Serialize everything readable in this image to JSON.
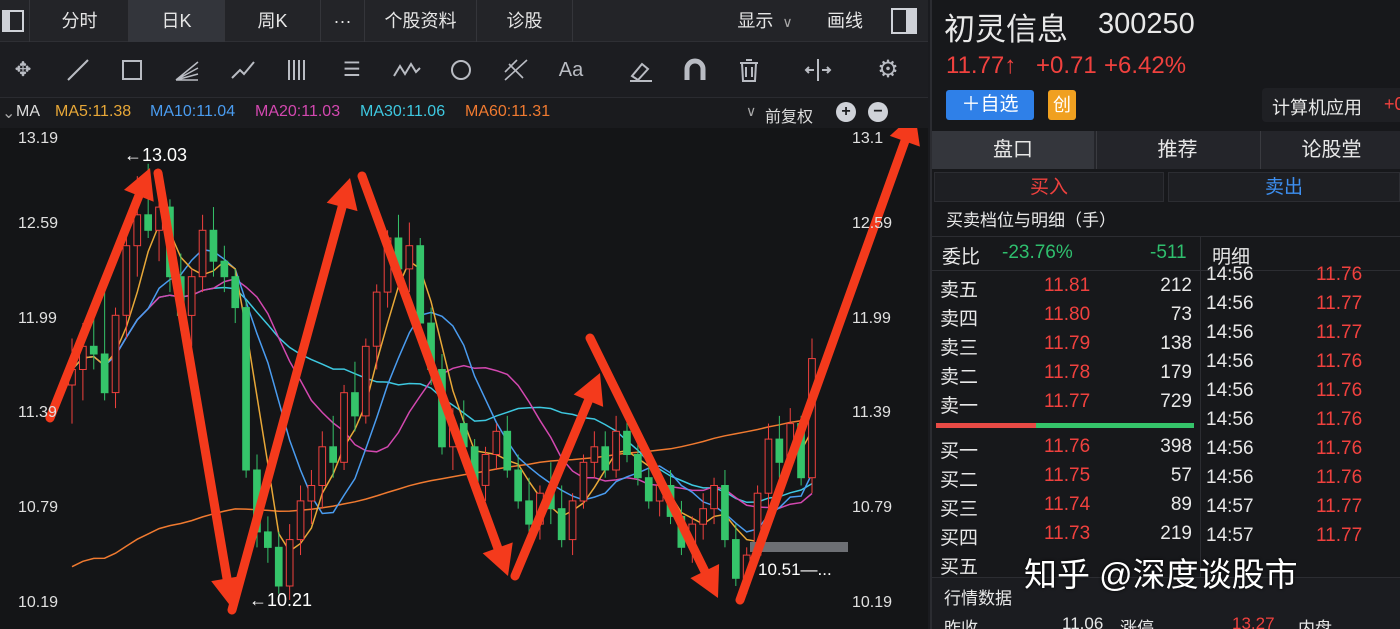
{
  "tabs": {
    "fenshi": "分时",
    "rik": "日K",
    "zhouk": "周K",
    "more": "···",
    "profile": "个股资料",
    "diagnose": "诊股",
    "display": "显示",
    "drawline": "画线"
  },
  "toolbar_icons": [
    "move-icon",
    "line-icon",
    "rect-icon",
    "fan-icon",
    "pen-icon",
    "bars-icon",
    "text-lines-icon",
    "wave-icon",
    "cycle-icon",
    "fib-icon",
    "text-icon",
    "eraser-icon",
    "magnet-icon",
    "trash-icon",
    "split-icon",
    "gear-icon"
  ],
  "ma_bar": {
    "label": "MA",
    "ma5": "MA5:11.38",
    "ma10": "MA10:11.04",
    "ma20": "MA20:11.03",
    "ma30": "MA30:11.06",
    "ma60": "MA60:11.31",
    "adjust": "前复权",
    "colors": {
      "ma5": "#e8a838",
      "ma10": "#4a9cf0",
      "ma20": "#d348b0",
      "ma30": "#3ec8e0",
      "ma60": "#f07a30"
    }
  },
  "chart_data": {
    "type": "candlestick",
    "y_ticks_left": [
      "13.19",
      "12.59",
      "11.99",
      "11.39",
      "10.79",
      "10.19"
    ],
    "y_ticks_right": [
      "13.1",
      "12.59",
      "11.99",
      "11.39",
      "10.79",
      "10.19"
    ],
    "ylim": [
      10.19,
      13.19
    ],
    "high_label": "←13.03",
    "low_label": "←10.21",
    "price_tag": "10.51—...",
    "up_color": "#f0413e",
    "down_color": "#35c46a",
    "candles": [
      {
        "o": 11.6,
        "h": 11.9,
        "l": 11.35,
        "c": 11.7
      },
      {
        "o": 11.7,
        "h": 12.0,
        "l": 11.5,
        "c": 11.85
      },
      {
        "o": 11.85,
        "h": 12.15,
        "l": 11.7,
        "c": 11.8
      },
      {
        "o": 11.8,
        "h": 12.2,
        "l": 11.5,
        "c": 11.55
      },
      {
        "o": 11.55,
        "h": 12.1,
        "l": 11.45,
        "c": 12.05
      },
      {
        "o": 12.05,
        "h": 12.6,
        "l": 11.9,
        "c": 12.5
      },
      {
        "o": 12.5,
        "h": 12.95,
        "l": 12.3,
        "c": 12.7
      },
      {
        "o": 12.7,
        "h": 13.03,
        "l": 12.55,
        "c": 12.6
      },
      {
        "o": 12.6,
        "h": 12.85,
        "l": 12.4,
        "c": 12.75
      },
      {
        "o": 12.75,
        "h": 12.8,
        "l": 12.2,
        "c": 12.3
      },
      {
        "o": 12.3,
        "h": 12.45,
        "l": 11.95,
        "c": 12.05
      },
      {
        "o": 12.05,
        "h": 12.35,
        "l": 11.85,
        "c": 12.3
      },
      {
        "o": 12.3,
        "h": 12.7,
        "l": 12.2,
        "c": 12.6
      },
      {
        "o": 12.6,
        "h": 12.75,
        "l": 12.3,
        "c": 12.4
      },
      {
        "o": 12.4,
        "h": 12.5,
        "l": 12.2,
        "c": 12.3
      },
      {
        "o": 12.3,
        "h": 12.35,
        "l": 12.0,
        "c": 12.1
      },
      {
        "o": 12.1,
        "h": 12.15,
        "l": 11.0,
        "c": 11.05
      },
      {
        "o": 11.05,
        "h": 11.15,
        "l": 10.55,
        "c": 10.65
      },
      {
        "o": 10.65,
        "h": 10.75,
        "l": 10.45,
        "c": 10.55
      },
      {
        "o": 10.55,
        "h": 10.65,
        "l": 10.25,
        "c": 10.3
      },
      {
        "o": 10.3,
        "h": 10.7,
        "l": 10.21,
        "c": 10.6
      },
      {
        "o": 10.6,
        "h": 10.95,
        "l": 10.5,
        "c": 10.85
      },
      {
        "o": 10.85,
        "h": 11.05,
        "l": 10.7,
        "c": 10.95
      },
      {
        "o": 10.95,
        "h": 11.3,
        "l": 10.8,
        "c": 11.2
      },
      {
        "o": 11.2,
        "h": 11.4,
        "l": 11.0,
        "c": 11.1
      },
      {
        "o": 11.1,
        "h": 11.6,
        "l": 11.05,
        "c": 11.55
      },
      {
        "o": 11.55,
        "h": 11.75,
        "l": 11.3,
        "c": 11.4
      },
      {
        "o": 11.4,
        "h": 11.9,
        "l": 11.35,
        "c": 11.85
      },
      {
        "o": 11.85,
        "h": 12.25,
        "l": 11.7,
        "c": 12.2
      },
      {
        "o": 12.2,
        "h": 12.6,
        "l": 12.1,
        "c": 12.55
      },
      {
        "o": 12.55,
        "h": 12.7,
        "l": 12.3,
        "c": 12.35
      },
      {
        "o": 12.35,
        "h": 12.65,
        "l": 12.2,
        "c": 12.5
      },
      {
        "o": 12.5,
        "h": 12.55,
        "l": 11.9,
        "c": 12.0
      },
      {
        "o": 12.0,
        "h": 12.1,
        "l": 11.6,
        "c": 11.7
      },
      {
        "o": 11.7,
        "h": 11.8,
        "l": 11.15,
        "c": 11.2
      },
      {
        "o": 11.2,
        "h": 11.45,
        "l": 11.05,
        "c": 11.35
      },
      {
        "o": 11.35,
        "h": 11.5,
        "l": 11.1,
        "c": 11.2
      },
      {
        "o": 11.2,
        "h": 11.25,
        "l": 10.9,
        "c": 10.95
      },
      {
        "o": 10.95,
        "h": 11.2,
        "l": 10.85,
        "c": 11.15
      },
      {
        "o": 11.15,
        "h": 11.35,
        "l": 11.05,
        "c": 11.3
      },
      {
        "o": 11.3,
        "h": 11.4,
        "l": 11.0,
        "c": 11.05
      },
      {
        "o": 11.05,
        "h": 11.15,
        "l": 10.8,
        "c": 10.85
      },
      {
        "o": 10.85,
        "h": 11.0,
        "l": 10.6,
        "c": 10.7
      },
      {
        "o": 10.7,
        "h": 10.95,
        "l": 10.6,
        "c": 10.9
      },
      {
        "o": 10.9,
        "h": 11.1,
        "l": 10.7,
        "c": 10.8
      },
      {
        "o": 10.8,
        "h": 10.95,
        "l": 10.55,
        "c": 10.6
      },
      {
        "o": 10.6,
        "h": 10.9,
        "l": 10.5,
        "c": 10.85
      },
      {
        "o": 10.85,
        "h": 11.15,
        "l": 10.8,
        "c": 11.1
      },
      {
        "o": 11.1,
        "h": 11.3,
        "l": 11.0,
        "c": 11.2
      },
      {
        "o": 11.2,
        "h": 11.3,
        "l": 11.0,
        "c": 11.05
      },
      {
        "o": 11.05,
        "h": 11.4,
        "l": 11.0,
        "c": 11.3
      },
      {
        "o": 11.3,
        "h": 11.45,
        "l": 11.1,
        "c": 11.15
      },
      {
        "o": 11.15,
        "h": 11.25,
        "l": 10.95,
        "c": 11.0
      },
      {
        "o": 11.0,
        "h": 11.1,
        "l": 10.8,
        "c": 10.85
      },
      {
        "o": 10.85,
        "h": 11.0,
        "l": 10.75,
        "c": 10.95
      },
      {
        "o": 10.95,
        "h": 11.05,
        "l": 10.7,
        "c": 10.75
      },
      {
        "o": 10.75,
        "h": 10.85,
        "l": 10.5,
        "c": 10.55
      },
      {
        "o": 10.55,
        "h": 10.75,
        "l": 10.45,
        "c": 10.7
      },
      {
        "o": 10.7,
        "h": 10.9,
        "l": 10.6,
        "c": 10.8
      },
      {
        "o": 10.8,
        "h": 11.0,
        "l": 10.7,
        "c": 10.95
      },
      {
        "o": 10.95,
        "h": 11.05,
        "l": 10.55,
        "c": 10.6
      },
      {
        "o": 10.6,
        "h": 10.7,
        "l": 10.3,
        "c": 10.35
      },
      {
        "o": 10.35,
        "h": 10.55,
        "l": 10.25,
        "c": 10.5
      },
      {
        "o": 10.5,
        "h": 10.95,
        "l": 10.45,
        "c": 10.9
      },
      {
        "o": 10.9,
        "h": 11.35,
        "l": 10.8,
        "c": 11.25
      },
      {
        "o": 11.25,
        "h": 11.4,
        "l": 11.0,
        "c": 11.1
      },
      {
        "o": 11.1,
        "h": 11.45,
        "l": 11.05,
        "c": 11.35
      },
      {
        "o": 11.35,
        "h": 11.4,
        "l": 10.95,
        "c": 11.0
      },
      {
        "o": 11.0,
        "h": 11.9,
        "l": 10.9,
        "c": 11.77
      }
    ],
    "arrows_note": "red zigzag arrows overlay"
  },
  "stock": {
    "name": "初灵信息",
    "code": "300250",
    "price": "11.77↑",
    "change": "+0.71",
    "pct": "+6.42%",
    "add_watch": "＋自选",
    "badge": "创",
    "industry": "计算机应用",
    "industry_chg": "+0"
  },
  "panel_tabs": {
    "t1": "盘口",
    "t2": "推荐",
    "t3": "论股堂"
  },
  "trade_tabs": {
    "buy": "买入",
    "sell": "卖出"
  },
  "depth_title": "买卖档位与明细（手）",
  "weibi": {
    "label": "委比",
    "pct": "-23.76%",
    "diff": "-511"
  },
  "detail_header": "明细",
  "asks": [
    {
      "label": "卖五",
      "price": "11.81",
      "vol": "212"
    },
    {
      "label": "卖四",
      "price": "11.80",
      "vol": "73"
    },
    {
      "label": "卖三",
      "price": "11.79",
      "vol": "138"
    },
    {
      "label": "卖二",
      "price": "11.78",
      "vol": "179"
    },
    {
      "label": "卖一",
      "price": "11.77",
      "vol": "729"
    }
  ],
  "bids": [
    {
      "label": "买一",
      "price": "11.76",
      "vol": "398"
    },
    {
      "label": "买二",
      "price": "11.75",
      "vol": "57"
    },
    {
      "label": "买三",
      "price": "11.74",
      "vol": "89"
    },
    {
      "label": "买四",
      "price": "11.73",
      "vol": "219"
    },
    {
      "label": "买五",
      "price": "",
      "vol": ""
    }
  ],
  "ticks": [
    {
      "time": "14:56",
      "price": "11.76"
    },
    {
      "time": "14:56",
      "price": "11.77"
    },
    {
      "time": "14:56",
      "price": "11.77"
    },
    {
      "time": "14:56",
      "price": "11.76"
    },
    {
      "time": "14:56",
      "price": "11.76"
    },
    {
      "time": "14:56",
      "price": "11.76"
    },
    {
      "time": "14:56",
      "price": "11.76"
    },
    {
      "time": "14:56",
      "price": "11.76"
    },
    {
      "time": "14:57",
      "price": "11.77"
    },
    {
      "time": "14:57",
      "price": "11.77"
    }
  ],
  "market_data": {
    "title": "行情数据",
    "prev_label": "昨收",
    "prev_val": "11.06",
    "limit_label": "涨停",
    "limit_val": "13.27",
    "inner_label": "内盘"
  },
  "watermark": "知乎 @深度谈股市"
}
